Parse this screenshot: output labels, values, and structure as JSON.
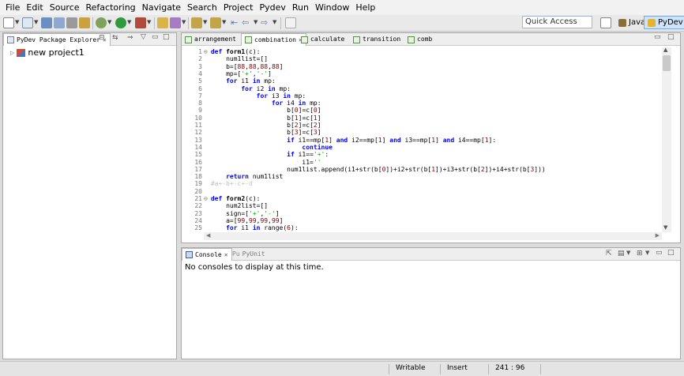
{
  "menu": [
    "File",
    "Edit",
    "Source",
    "Refactoring",
    "Navigate",
    "Search",
    "Project",
    "Pydev",
    "Run",
    "Window",
    "Help"
  ],
  "quick_access": {
    "placeholder": "Quick Access"
  },
  "perspectives": [
    {
      "label": "Java",
      "icon": "java-perspective-icon",
      "selected": false
    },
    {
      "label": "PyDev",
      "icon": "pydev-perspective-icon",
      "selected": true
    }
  ],
  "explorer": {
    "tab_label": "PyDev Package Explorer",
    "items": [
      {
        "label": "new project1",
        "icon": "python-project-icon"
      }
    ]
  },
  "editor": {
    "tabs": [
      {
        "label": "arrangement",
        "active": false
      },
      {
        "label": "combination",
        "active": true
      },
      {
        "label": "calculate",
        "active": false
      },
      {
        "label": "transition",
        "active": false
      },
      {
        "label": "comb",
        "active": false
      }
    ],
    "lines": [
      {
        "n": "1",
        "fold": "⊖",
        "code": [
          {
            "t": "def ",
            "c": "kw"
          },
          {
            "t": "form1",
            "c": "fnm"
          },
          {
            "t": "(c):",
            "c": ""
          }
        ]
      },
      {
        "n": "2",
        "code": [
          {
            "t": "    num1list=[]",
            "c": ""
          }
        ]
      },
      {
        "n": "3",
        "code": [
          {
            "t": "    b=[",
            "c": ""
          },
          {
            "t": "88",
            "c": "num"
          },
          {
            "t": ",",
            "c": ""
          },
          {
            "t": "88",
            "c": "num"
          },
          {
            "t": ",",
            "c": ""
          },
          {
            "t": "88",
            "c": "num"
          },
          {
            "t": ",",
            "c": ""
          },
          {
            "t": "88",
            "c": "num"
          },
          {
            "t": "]",
            "c": ""
          }
        ]
      },
      {
        "n": "4",
        "code": [
          {
            "t": "    mp=[",
            "c": ""
          },
          {
            "t": "'+'",
            "c": "str"
          },
          {
            "t": ",",
            "c": ""
          },
          {
            "t": "'-'",
            "c": "str"
          },
          {
            "t": "]",
            "c": ""
          }
        ]
      },
      {
        "n": "5",
        "code": [
          {
            "t": "    ",
            "c": ""
          },
          {
            "t": "for",
            "c": "kw"
          },
          {
            "t": " i1 ",
            "c": ""
          },
          {
            "t": "in",
            "c": "kw"
          },
          {
            "t": " mp:",
            "c": ""
          }
        ]
      },
      {
        "n": "6",
        "code": [
          {
            "t": "        ",
            "c": ""
          },
          {
            "t": "for",
            "c": "kw"
          },
          {
            "t": " i2 ",
            "c": ""
          },
          {
            "t": "in",
            "c": "kw"
          },
          {
            "t": " mp:",
            "c": ""
          }
        ]
      },
      {
        "n": "7",
        "code": [
          {
            "t": "            ",
            "c": ""
          },
          {
            "t": "for",
            "c": "kw"
          },
          {
            "t": " i3 ",
            "c": ""
          },
          {
            "t": "in",
            "c": "kw"
          },
          {
            "t": " mp:",
            "c": ""
          }
        ]
      },
      {
        "n": "8",
        "code": [
          {
            "t": "                ",
            "c": ""
          },
          {
            "t": "for",
            "c": "kw"
          },
          {
            "t": " i4 ",
            "c": ""
          },
          {
            "t": "in",
            "c": "kw"
          },
          {
            "t": " mp:",
            "c": ""
          }
        ]
      },
      {
        "n": "9",
        "code": [
          {
            "t": "                    b[",
            "c": ""
          },
          {
            "t": "0",
            "c": "num"
          },
          {
            "t": "]=c[",
            "c": ""
          },
          {
            "t": "0",
            "c": "num"
          },
          {
            "t": "]",
            "c": ""
          }
        ]
      },
      {
        "n": "10",
        "code": [
          {
            "t": "                    b[",
            "c": ""
          },
          {
            "t": "1",
            "c": "num"
          },
          {
            "t": "]=c[",
            "c": ""
          },
          {
            "t": "1",
            "c": "num"
          },
          {
            "t": "]",
            "c": ""
          }
        ]
      },
      {
        "n": "11",
        "code": [
          {
            "t": "                    b[",
            "c": ""
          },
          {
            "t": "2",
            "c": "num"
          },
          {
            "t": "]=c[",
            "c": ""
          },
          {
            "t": "2",
            "c": "num"
          },
          {
            "t": "]",
            "c": ""
          }
        ]
      },
      {
        "n": "12",
        "code": [
          {
            "t": "                    b[",
            "c": ""
          },
          {
            "t": "3",
            "c": "num"
          },
          {
            "t": "]=c[",
            "c": ""
          },
          {
            "t": "3",
            "c": "num"
          },
          {
            "t": "]",
            "c": ""
          }
        ]
      },
      {
        "n": "13",
        "code": [
          {
            "t": "                    ",
            "c": ""
          },
          {
            "t": "if",
            "c": "kw"
          },
          {
            "t": " i1==mp[",
            "c": ""
          },
          {
            "t": "1",
            "c": "num"
          },
          {
            "t": "] ",
            "c": ""
          },
          {
            "t": "and",
            "c": "kw"
          },
          {
            "t": " i2==mp[",
            "c": ""
          },
          {
            "t": "1",
            "c": "num"
          },
          {
            "t": "] ",
            "c": ""
          },
          {
            "t": "and",
            "c": "kw"
          },
          {
            "t": " i3==mp[",
            "c": ""
          },
          {
            "t": "1",
            "c": "num"
          },
          {
            "t": "] ",
            "c": ""
          },
          {
            "t": "and",
            "c": "kw"
          },
          {
            "t": " i4==mp[",
            "c": ""
          },
          {
            "t": "1",
            "c": "num"
          },
          {
            "t": "]:",
            "c": ""
          }
        ]
      },
      {
        "n": "14",
        "code": [
          {
            "t": "                        ",
            "c": ""
          },
          {
            "t": "continue",
            "c": "kw"
          }
        ]
      },
      {
        "n": "15",
        "code": [
          {
            "t": "                    ",
            "c": ""
          },
          {
            "t": "if",
            "c": "kw"
          },
          {
            "t": " i1==",
            "c": ""
          },
          {
            "t": "'+'",
            "c": "str"
          },
          {
            "t": ":",
            "c": ""
          }
        ]
      },
      {
        "n": "16",
        "code": [
          {
            "t": "                        i1=",
            "c": ""
          },
          {
            "t": "''",
            "c": "str"
          }
        ]
      },
      {
        "n": "17",
        "code": [
          {
            "t": "                    num1list.append(i1+str(b[",
            "c": ""
          },
          {
            "t": "0",
            "c": "num"
          },
          {
            "t": "])+i2+str(b[",
            "c": ""
          },
          {
            "t": "1",
            "c": "num"
          },
          {
            "t": "])+i3+str(b[",
            "c": ""
          },
          {
            "t": "2",
            "c": "num"
          },
          {
            "t": "])+i4+str(b[",
            "c": ""
          },
          {
            "t": "3",
            "c": "num"
          },
          {
            "t": "]))",
            "c": ""
          }
        ]
      },
      {
        "n": "18",
        "code": [
          {
            "t": "    ",
            "c": ""
          },
          {
            "t": "return",
            "c": "kw"
          },
          {
            "t": " num1list",
            "c": ""
          }
        ]
      },
      {
        "n": "19",
        "code": [
          {
            "t": "#a+-b+-c+-d",
            "c": "cmt"
          }
        ]
      },
      {
        "n": "20",
        "code": []
      },
      {
        "n": "21",
        "fold": "⊖",
        "code": [
          {
            "t": "def ",
            "c": "kw"
          },
          {
            "t": "form2",
            "c": "fnm"
          },
          {
            "t": "(c):",
            "c": ""
          }
        ]
      },
      {
        "n": "22",
        "code": [
          {
            "t": "    num2list=[]",
            "c": ""
          }
        ]
      },
      {
        "n": "23",
        "code": [
          {
            "t": "    sign=[",
            "c": ""
          },
          {
            "t": "'+'",
            "c": "str"
          },
          {
            "t": ",",
            "c": ""
          },
          {
            "t": "'-'",
            "c": "str"
          },
          {
            "t": "]",
            "c": ""
          }
        ]
      },
      {
        "n": "24",
        "code": [
          {
            "t": "    a=[",
            "c": ""
          },
          {
            "t": "99",
            "c": "num"
          },
          {
            "t": ",",
            "c": ""
          },
          {
            "t": "99",
            "c": "num"
          },
          {
            "t": ",",
            "c": ""
          },
          {
            "t": "99",
            "c": "num"
          },
          {
            "t": ",",
            "c": ""
          },
          {
            "t": "99",
            "c": "num"
          },
          {
            "t": "]",
            "c": ""
          }
        ]
      },
      {
        "n": "25",
        "code": [
          {
            "t": "    ",
            "c": ""
          },
          {
            "t": "for",
            "c": "kw"
          },
          {
            "t": " i1 ",
            "c": ""
          },
          {
            "t": "in",
            "c": "kw"
          },
          {
            "t": " range(",
            "c": ""
          },
          {
            "t": "6",
            "c": "num"
          },
          {
            "t": "):",
            "c": ""
          }
        ]
      }
    ]
  },
  "console": {
    "tabs": [
      {
        "label": "Console",
        "active": true
      },
      {
        "label": "PyUnit",
        "active": false
      }
    ],
    "message": "No consoles to display at this time."
  },
  "status": {
    "writable": "Writable",
    "mode": "Insert",
    "position": "241 : 96"
  }
}
